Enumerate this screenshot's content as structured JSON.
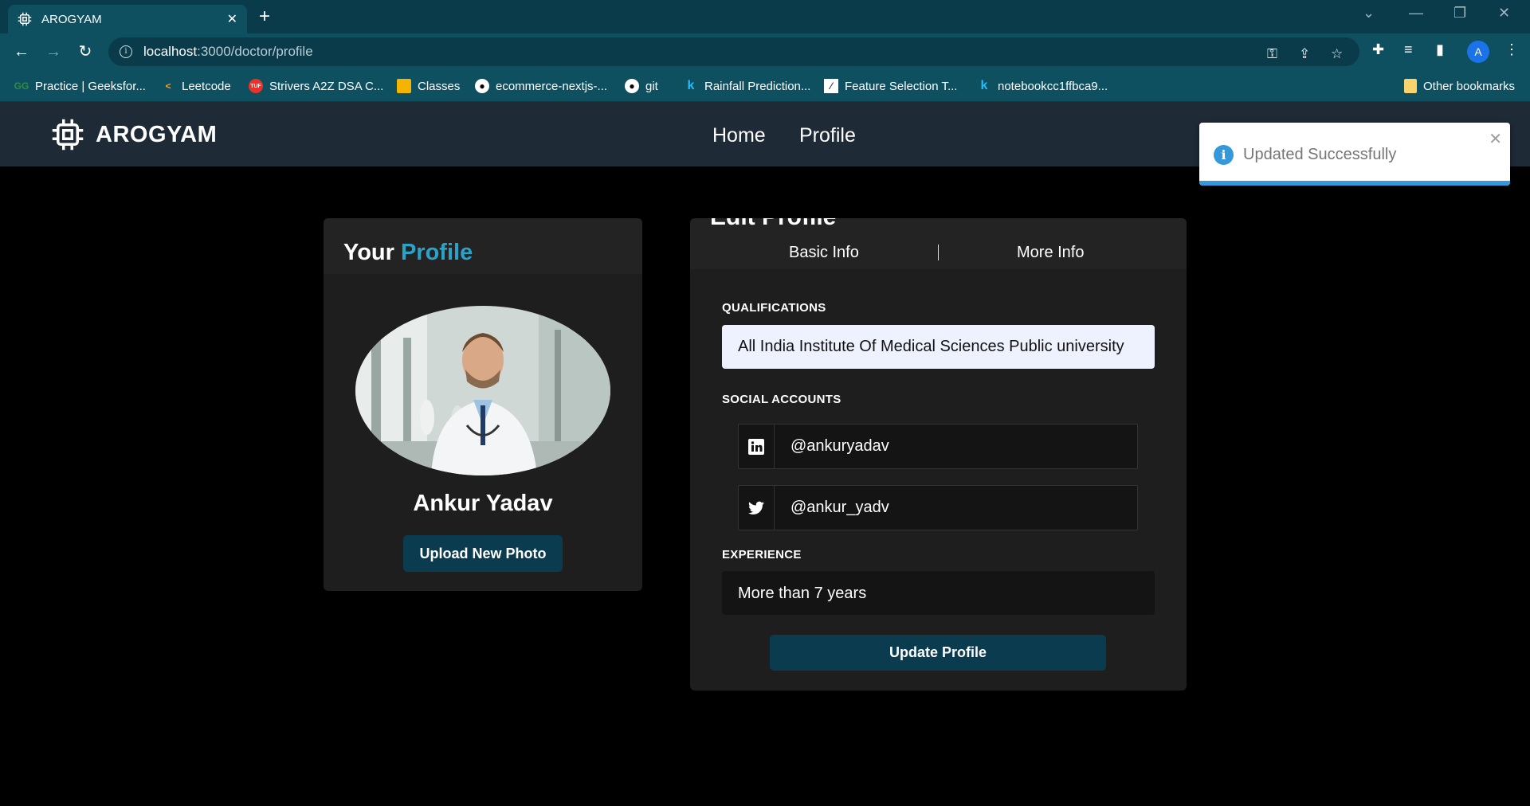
{
  "browser": {
    "tab_title": "AROGYAM",
    "tab_close": "✕",
    "new_tab": "+",
    "url_host": "localhost",
    "url_path": ":3000/doctor/profile",
    "profile_initial": "A",
    "bookmarks": [
      {
        "label": "Practice | Geeksfor...",
        "icon": "geeksforgeeks-icon",
        "color": "#2f8d46"
      },
      {
        "label": "Leetcode",
        "icon": "leetcode-icon",
        "color": "#ffa116"
      },
      {
        "label": "Strivers A2Z DSA C...",
        "icon": "tuf-icon",
        "color": "#e8322b"
      },
      {
        "label": "Classes",
        "icon": "classroom-icon",
        "color": "#f4b400"
      },
      {
        "label": "ecommerce-nextjs-...",
        "icon": "github-icon",
        "color": "#ffffff"
      },
      {
        "label": "git",
        "icon": "github-icon",
        "color": "#ffffff"
      },
      {
        "label": "Rainfall Prediction...",
        "icon": "kaggle-icon",
        "color": "#20beff"
      },
      {
        "label": "Feature Selection T...",
        "icon": "chart-icon",
        "color": "#ffffff"
      },
      {
        "label": "notebookcc1ffbca9...",
        "icon": "kaggle-icon",
        "color": "#20beff"
      }
    ],
    "other_bookmarks": "Other bookmarks"
  },
  "header": {
    "brand": "AROGYAM",
    "nav": [
      "Home",
      "Profile"
    ]
  },
  "toast": {
    "message": "Updated Successfully",
    "close": "✕",
    "accent": "#3498db"
  },
  "profile_card": {
    "title_plain": "Your",
    "title_accent": "Profile",
    "accent_color": "#2aa3c9",
    "name": "Ankur Yadav",
    "upload_label": "Upload New Photo"
  },
  "edit_card": {
    "title": "Edit Profile",
    "tabs": [
      "Basic Info",
      "More Info"
    ],
    "qualifications_label": "QUALIFICATIONS",
    "qualifications_value": "All India Institute Of Medical Sciences Public university",
    "social_label": "SOCIAL ACCOUNTS",
    "linkedin": "@ankuryadav",
    "twitter": "@ankur_yadv",
    "experience_label": "EXPERIENCE",
    "experience_value": "More than 7 years",
    "update_label": "Update Profile",
    "button_color": "#0b3b4f"
  }
}
